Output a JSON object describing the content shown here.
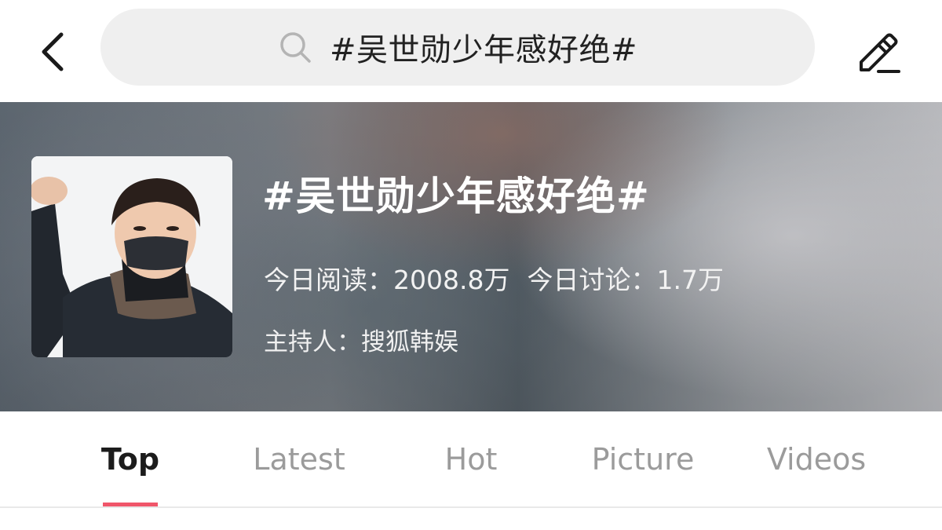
{
  "header": {
    "search_query": "#吴世勋少年感好绝#"
  },
  "topic": {
    "title": "#吴世勋少年感好绝#",
    "reads_label": "今日阅读：",
    "reads_value": "2008.8万",
    "discussions_label": "今日讨论：",
    "discussions_value": "1.7万",
    "host_label": "主持人：",
    "host_name": "搜狐韩娱"
  },
  "tabs": [
    {
      "label": "Top",
      "active": true
    },
    {
      "label": "Latest",
      "active": false
    },
    {
      "label": "Hot",
      "active": false
    },
    {
      "label": "Picture",
      "active": false
    },
    {
      "label": "Videos",
      "active": false
    }
  ],
  "colors": {
    "accent": "#f0566a",
    "tab_inactive": "#9b9b9b",
    "tab_active": "#1c1c1c",
    "search_bg": "#efefef"
  },
  "icons": {
    "back": "chevron-left-icon",
    "search": "search-icon",
    "edit": "pencil-icon"
  }
}
